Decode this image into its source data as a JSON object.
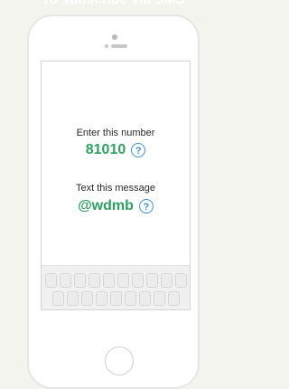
{
  "header": {
    "title": "To subscribe via SMS"
  },
  "screen": {
    "number_prompt": "Enter this number",
    "number_value": "81010",
    "message_prompt": "Text this message",
    "message_value": "@wdmb",
    "help_glyph": "?"
  },
  "colors": {
    "accent_green": "#2f9e62",
    "help_blue": "#3b8fd8",
    "background": "#f3f4ee"
  },
  "icons": {
    "help": "question-mark-circle",
    "home_button": "circle",
    "camera": "dot",
    "speaker": "rounded-slot"
  }
}
